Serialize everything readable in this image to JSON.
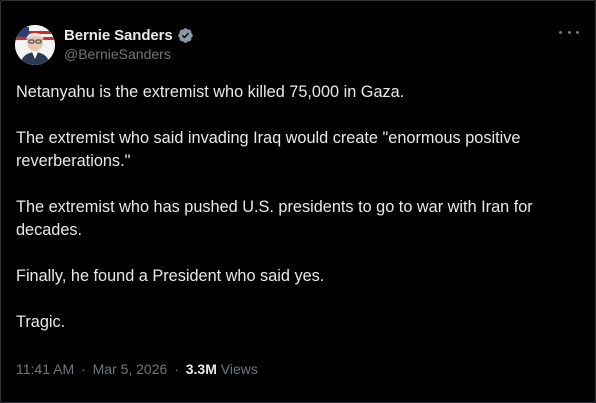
{
  "author": {
    "display_name": "Bernie Sanders",
    "handle": "@BernieSanders",
    "verified": true
  },
  "icons": {
    "verified": "verified-badge-icon",
    "more": "more-options-icon",
    "avatar": "profile-photo"
  },
  "colors": {
    "background": "#000000",
    "text": "#e7e9ea",
    "secondary": "#71767b",
    "verified_badge": "#8b98a5"
  },
  "tweet": {
    "paragraphs": [
      "Netanyahu is the extremist who killed 75,000 in Gaza.",
      "The extremist who said invading Iraq would create \"enormous positive reverberations.\"",
      "The extremist who has pushed U.S. presidents to go to war with Iran for decades.",
      "Finally, he found a President who said yes.",
      "Tragic."
    ]
  },
  "meta": {
    "time": "11:41 AM",
    "date": "Mar 5, 2026",
    "separator": "·",
    "views_count": "3.3M",
    "views_label": "Views"
  }
}
